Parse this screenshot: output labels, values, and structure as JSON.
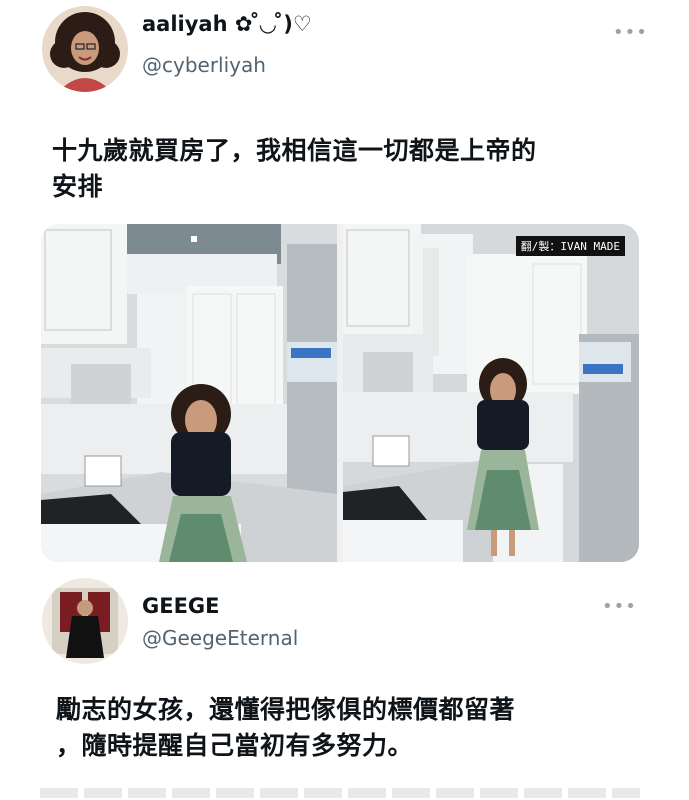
{
  "tweet1": {
    "display_name": "aaliyah ✿ ̊◡ ̊)♡",
    "handle": "@cyberliyah",
    "more_icon": "more-options-icon",
    "text_line1": "十九歲就買房了，我相信這一切都是上帝的",
    "text_line2": "安排",
    "watermark": "翻/製：IVAN MADE"
  },
  "tweet2": {
    "display_name": "GEEGE",
    "handle": "@GeegeEternal",
    "more_icon": "more-options-icon",
    "text_line1": "勵志的女孩，還懂得把傢俱的標價都留著",
    "text_line2": "，隨時提醒自己當初有多努力。"
  },
  "colors": {
    "text": "#0f1419",
    "secondary": "#536471",
    "background": "#ffffff"
  }
}
